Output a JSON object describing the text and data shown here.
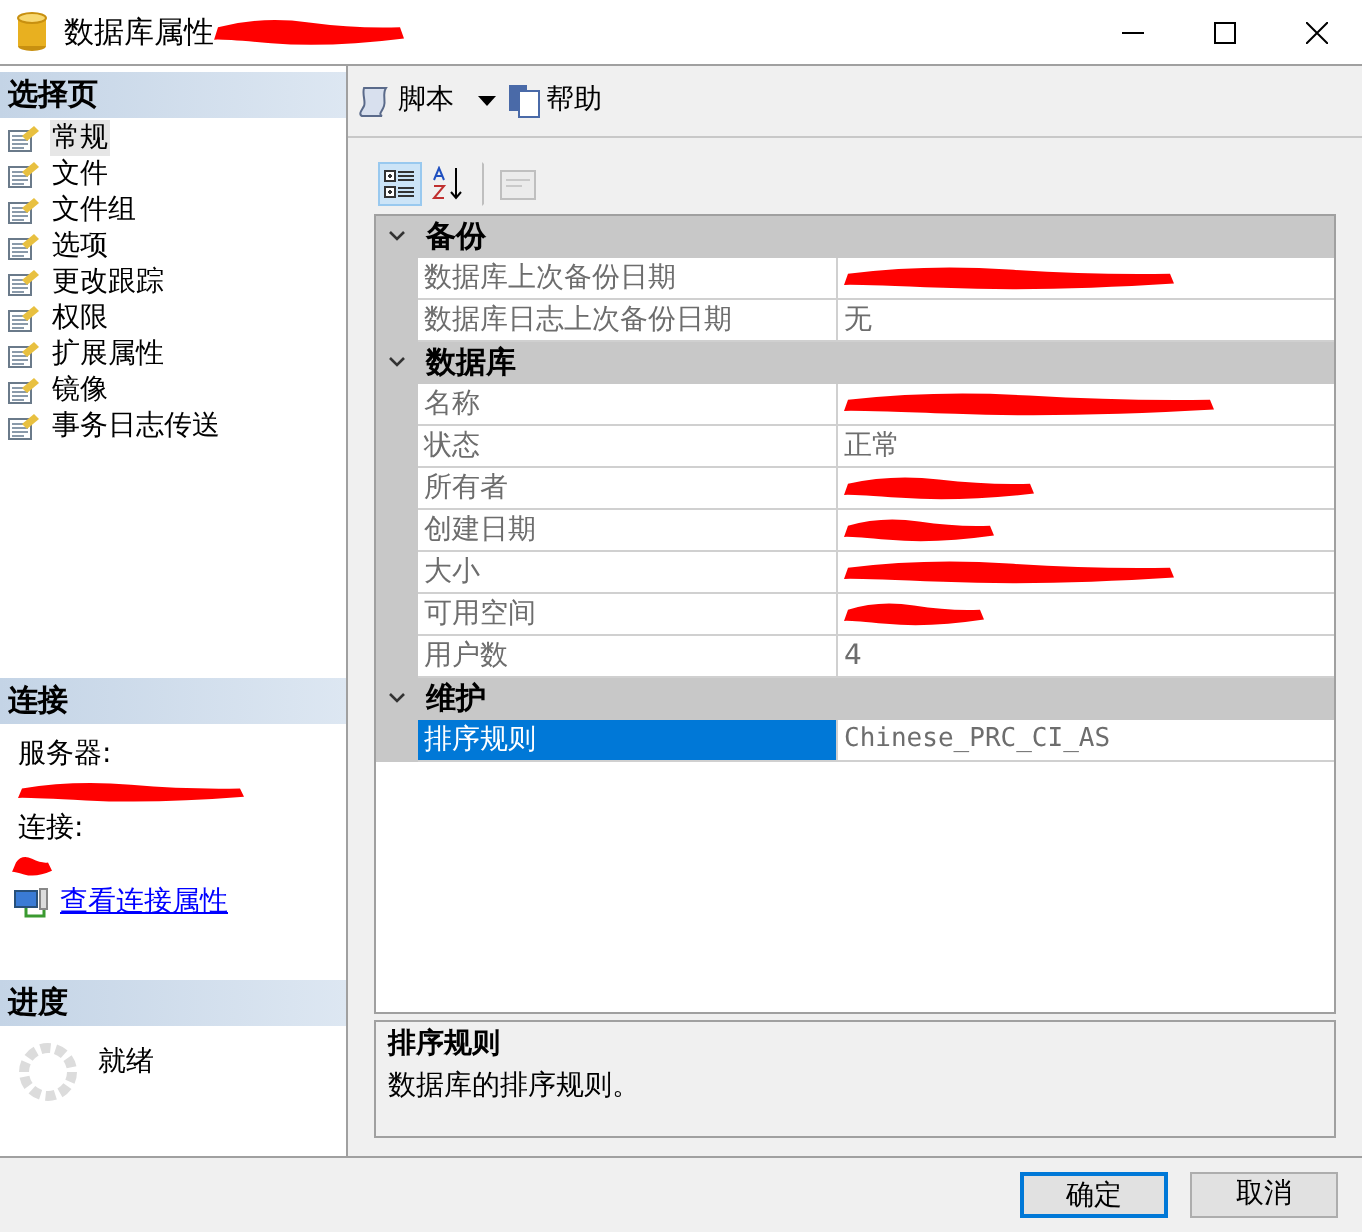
{
  "window": {
    "title": "数据库属性",
    "title_redacted": true
  },
  "sidebar": {
    "header": "选择页",
    "items": [
      {
        "label": "常规",
        "selected": true
      },
      {
        "label": "文件",
        "selected": false
      },
      {
        "label": "文件组",
        "selected": false
      },
      {
        "label": "选项",
        "selected": false
      },
      {
        "label": "更改跟踪",
        "selected": false
      },
      {
        "label": "权限",
        "selected": false
      },
      {
        "label": "扩展属性",
        "selected": false
      },
      {
        "label": "镜像",
        "selected": false
      },
      {
        "label": "事务日志传送",
        "selected": false
      }
    ]
  },
  "connection": {
    "header": "连接",
    "server_label": "服务器:",
    "server_redacted": true,
    "connection_label": "连接:",
    "connection_redacted": true,
    "link": "查看连接属性"
  },
  "progress": {
    "header": "进度",
    "status": "就绪"
  },
  "toolbar": {
    "script": "脚本",
    "help": "帮助"
  },
  "grid_buttons": [
    {
      "kind": "categorized",
      "selected": true
    },
    {
      "kind": "alphabetical",
      "selected": false
    },
    {
      "kind": "pages",
      "disabled": true
    }
  ],
  "categories": [
    {
      "name": "备份",
      "expanded": true,
      "properties": [
        {
          "name": "数据库上次备份日期",
          "redacted": true,
          "selected": false
        },
        {
          "name": "数据库日志上次备份日期",
          "value": "无",
          "redacted": false,
          "selected": false
        }
      ]
    },
    {
      "name": "数据库",
      "expanded": true,
      "properties": [
        {
          "name": "名称",
          "redacted": true,
          "selected": false
        },
        {
          "name": "状态",
          "value": "正常",
          "redacted": false,
          "selected": false
        },
        {
          "name": "所有者",
          "redacted": true,
          "selected": false
        },
        {
          "name": "创建日期",
          "redacted": true,
          "selected": false
        },
        {
          "name": "大小",
          "redacted": true,
          "selected": false
        },
        {
          "name": "可用空间",
          "redacted": true,
          "selected": false
        },
        {
          "name": "用户数",
          "value": "4",
          "redacted": false,
          "selected": false
        }
      ]
    },
    {
      "name": "维护",
      "expanded": true,
      "properties": [
        {
          "name": "排序规则",
          "value": "Chinese_PRC_CI_AS",
          "redacted": false,
          "selected": true
        }
      ]
    }
  ],
  "description": {
    "title": "排序规则",
    "text": "数据库的排序规则。"
  },
  "buttons": [
    {
      "label": "确定",
      "default": true
    },
    {
      "label": "取消",
      "default": false
    }
  ]
}
